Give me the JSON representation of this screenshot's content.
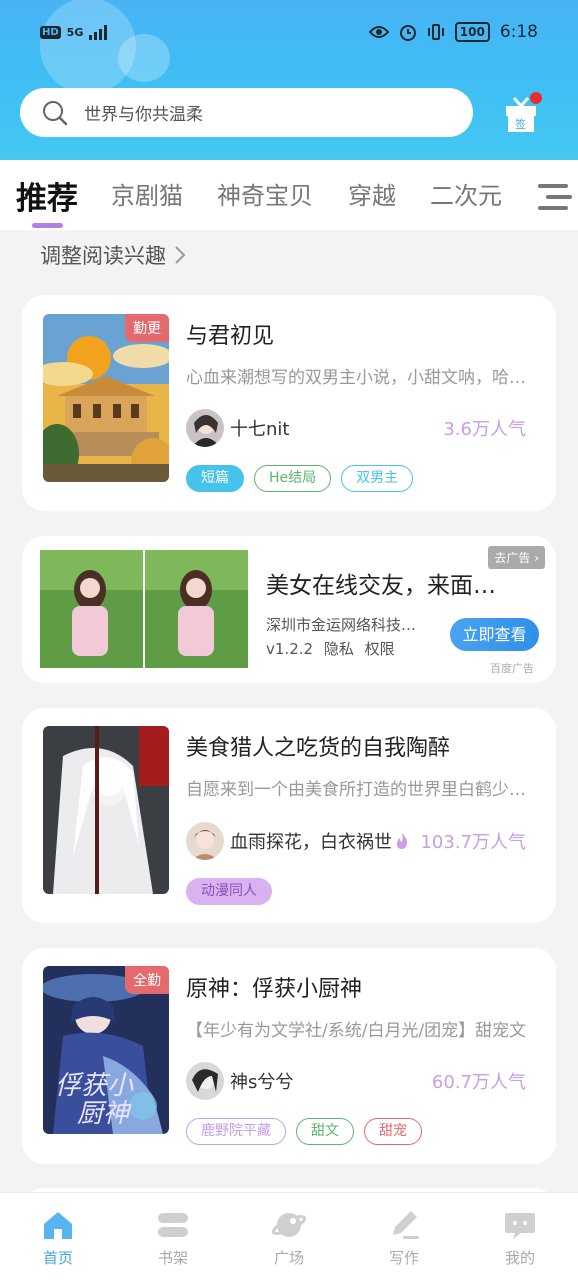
{
  "status_bar": {
    "hd": "HD",
    "network": "5G",
    "time": "6:18",
    "battery": "100"
  },
  "search": {
    "placeholder": "世界与你共温柔"
  },
  "sign_in": {
    "label": "签"
  },
  "tabs": [
    "推荐",
    "京剧猫",
    "神奇宝贝",
    "穿越",
    "二次元"
  ],
  "interest_link": "调整阅读兴趣",
  "books": [
    {
      "title": "与君初见",
      "badge": "勤更",
      "desc": "心血来潮想写的双男主小说，小甜文呐，哈哈哈",
      "author": "十七nit",
      "popularity": "3.6万人气",
      "tags": [
        {
          "label": "短篇",
          "color": "#45c3ea",
          "filled": true
        },
        {
          "label": "He结局",
          "color": "#5ab86c",
          "filled": false
        },
        {
          "label": "双男主",
          "color": "#45c3ea",
          "filled": false
        }
      ]
    },
    {
      "title": "美食猎人之吃货的自我陶醉",
      "badge": "",
      "desc": "自愿来到一个由美食所打造的世界里白鹤少年的故事",
      "author": "血雨探花，白衣祸世",
      "popularity": "103.7万人气",
      "tags": [
        {
          "label": "动漫同人",
          "color": "#b37fe0",
          "filled": true
        }
      ]
    },
    {
      "title": "原神：俘获小厨神",
      "badge": "全勤",
      "desc": "【年少有为文学社/系统/白月光/团宠】甜宠文",
      "author": "神s兮兮",
      "popularity": "60.7万人气",
      "tags": [
        {
          "label": "鹿野院平藏",
          "color": "#c89ee6",
          "filled": false
        },
        {
          "label": "甜文",
          "color": "#5ab86c",
          "filled": false
        },
        {
          "label": "甜宠",
          "color": "#e46a6e",
          "filled": false
        }
      ]
    }
  ],
  "ad": {
    "title": "美女在线交友，来面基吧",
    "company": "深圳市金运网络科技有限公司",
    "version": "v1.2.2",
    "privacy": "隐私",
    "permissions": "权限",
    "close_label": "去广告",
    "button": "立即查看",
    "source": "百度广告"
  },
  "nav": [
    {
      "label": "首页",
      "icon": "home-icon",
      "active": true
    },
    {
      "label": "书架",
      "icon": "bookshelf-icon",
      "active": false
    },
    {
      "label": "广场",
      "icon": "planet-icon",
      "active": false
    },
    {
      "label": "写作",
      "icon": "pen-icon",
      "active": false
    },
    {
      "label": "我的",
      "icon": "chat-bubble-icon",
      "active": false
    }
  ],
  "colors": {
    "accent": "#3fa3ef",
    "header": "#45bef4",
    "popularity": "#c89ee6",
    "badge": "#e46a6e"
  }
}
